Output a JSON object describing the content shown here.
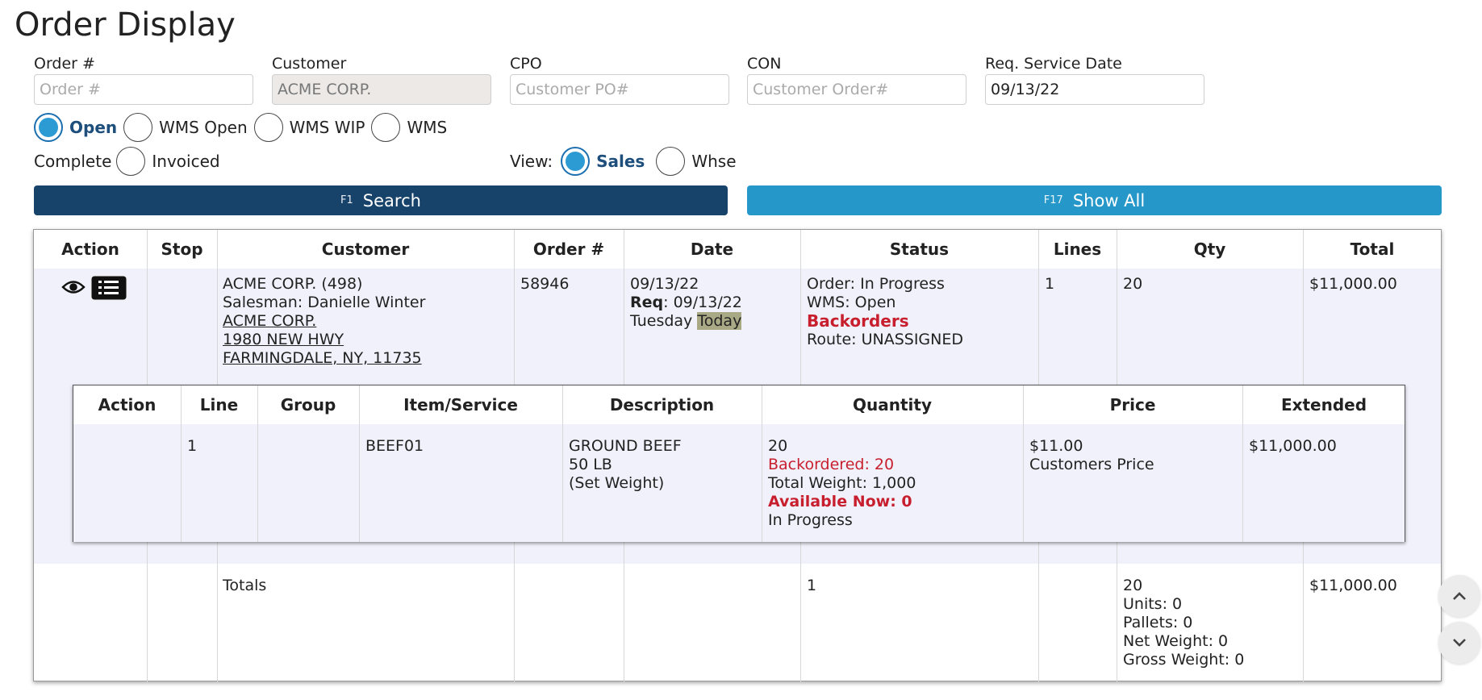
{
  "page": {
    "title": "Order Display"
  },
  "filters": {
    "order": {
      "label": "Order #",
      "placeholder": "Order #",
      "value": ""
    },
    "customer": {
      "label": "Customer",
      "value": "ACME CORP."
    },
    "cpo": {
      "label": "CPO",
      "placeholder": "Customer PO#",
      "value": ""
    },
    "con": {
      "label": "CON",
      "placeholder": "Customer Order#",
      "value": ""
    },
    "service_date": {
      "label": "Req. Service Date",
      "value": "09/13/22"
    },
    "status_options": [
      "Open",
      "WMS Open",
      "WMS WIP",
      "WMS",
      "Complete",
      "Invoiced"
    ],
    "status_selected": "Open",
    "view_label": "View:",
    "view_options": [
      "Sales",
      "Whse"
    ],
    "view_selected": "Sales"
  },
  "buttons": {
    "search": {
      "key": "F1",
      "label": "Search"
    },
    "show_all": {
      "key": "F17",
      "label": "Show All"
    }
  },
  "orders_table": {
    "headers": [
      "Action",
      "Stop",
      "Customer",
      "Order #",
      "Date",
      "Status",
      "Lines",
      "Qty",
      "Total"
    ],
    "row": {
      "stop": "",
      "customer_name": "ACME CORP. (498)",
      "salesman": "Salesman: Danielle Winter",
      "ship_name": "ACME CORP.",
      "address1": "1980 NEW HWY",
      "address2": "FARMINGDALE, NY, 11735",
      "order_no": "58946",
      "date": "09/13/22",
      "req_label": "Req",
      "req_date": ": 09/13/22",
      "weekday": "Tuesday",
      "today": "Today",
      "status_order": "Order: In Progress",
      "status_wms": "WMS: Open",
      "status_backorders": "Backorders",
      "status_route": "Route: UNASSIGNED",
      "lines": "1",
      "qty": "20",
      "total": "$11,000.00"
    },
    "totals": {
      "label": "Totals",
      "status_col": "1",
      "qty": "20",
      "units": "Units: 0",
      "pallets": "Pallets: 0",
      "net_weight": "Net Weight: 0",
      "gross_weight": "Gross Weight: 0",
      "total": "$11,000.00"
    }
  },
  "lines_table": {
    "headers": [
      "Action",
      "Line",
      "Group",
      "Item/Service",
      "Description",
      "Quantity",
      "Price",
      "Extended"
    ],
    "row": {
      "line": "1",
      "group": "",
      "item": "BEEF01",
      "desc1": "GROUND BEEF",
      "desc2": "50 LB",
      "desc3": "(Set Weight)",
      "qty": "20",
      "backordered": "Backordered: 20",
      "total_weight": "Total Weight: 1,000",
      "available_now": "Available Now: 0",
      "line_status": "In Progress",
      "price": "$11.00",
      "price_type": "Customers Price",
      "extended": "$11,000.00"
    }
  },
  "colors": {
    "primary": "#17426a",
    "secondary": "#2597c9",
    "alert": "#c81f2e",
    "row_highlight": "#f1f1fb"
  }
}
